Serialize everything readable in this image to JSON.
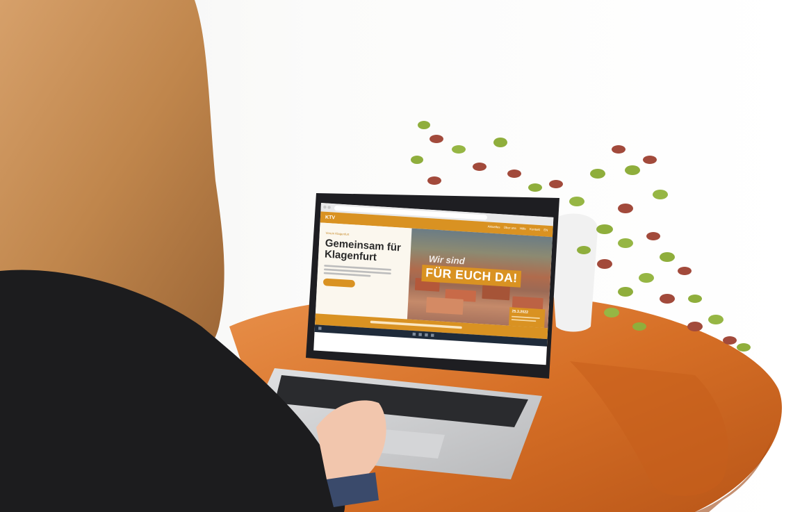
{
  "scene": {
    "description_colors": {
      "hair": "#c48a4a",
      "jacket": "#1c1c1e",
      "table": "#d9742a",
      "laptop": "#c9cacc",
      "screen_bezel": "#1e1e22",
      "brand_accent": "#d99222",
      "plant_leaf": "#8fae3c",
      "plant_leaf_red": "#a24a3b",
      "pot": "#f2f2f2"
    }
  },
  "website": {
    "logo": "KTV",
    "nav": [
      "Aktuelles",
      "Über uns",
      "Hilfe",
      "Kontakt",
      "EN"
    ],
    "eyebrow": "Verein Klagenfurt",
    "headline": "Gemeinsam für Klagenfurt",
    "hero_overlay_top": "Wir sind",
    "hero_overlay_main": "FÜR EUCH DA!",
    "date_badge": "25.3.2022"
  }
}
